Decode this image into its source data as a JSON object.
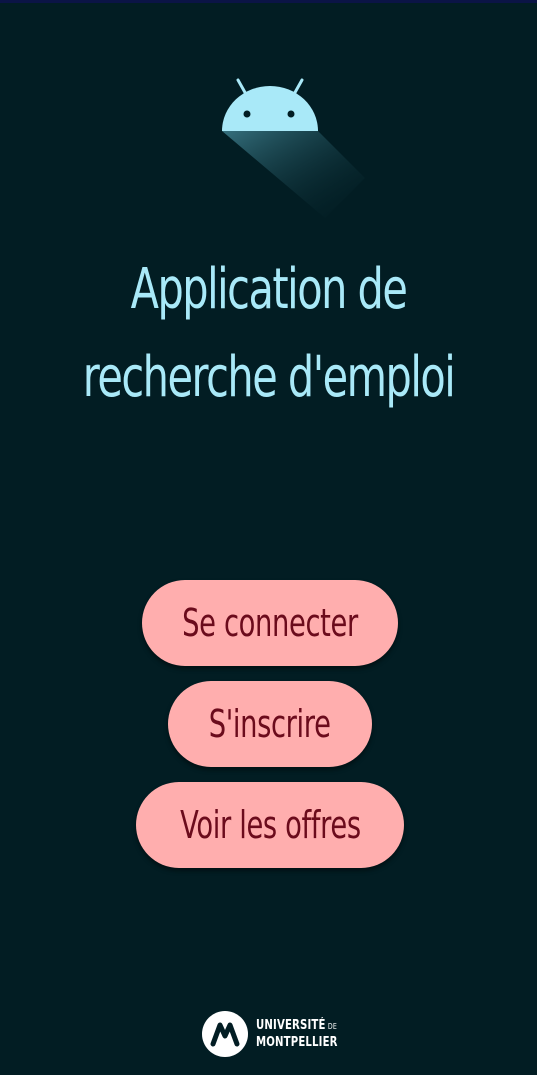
{
  "app": {
    "title_line1": "Application de",
    "title_line2": "recherche d'emploi",
    "logo_icon": "android-icon"
  },
  "actions": {
    "login_label": "Se connecter",
    "signup_label": "S'inscrire",
    "offers_label": "Voir les offres"
  },
  "footer": {
    "logo_icon": "universite-montpellier-logo",
    "logo_line1": "UNIVERSITÉ",
    "logo_line1_suffix": "DE",
    "logo_line2": "MONTPELLIER"
  },
  "colors": {
    "background": "#021d23",
    "title": "#a9e9f8",
    "button_fill": "#ffaeae",
    "button_text": "#6b0b1c",
    "android": "#a9e9f8"
  }
}
